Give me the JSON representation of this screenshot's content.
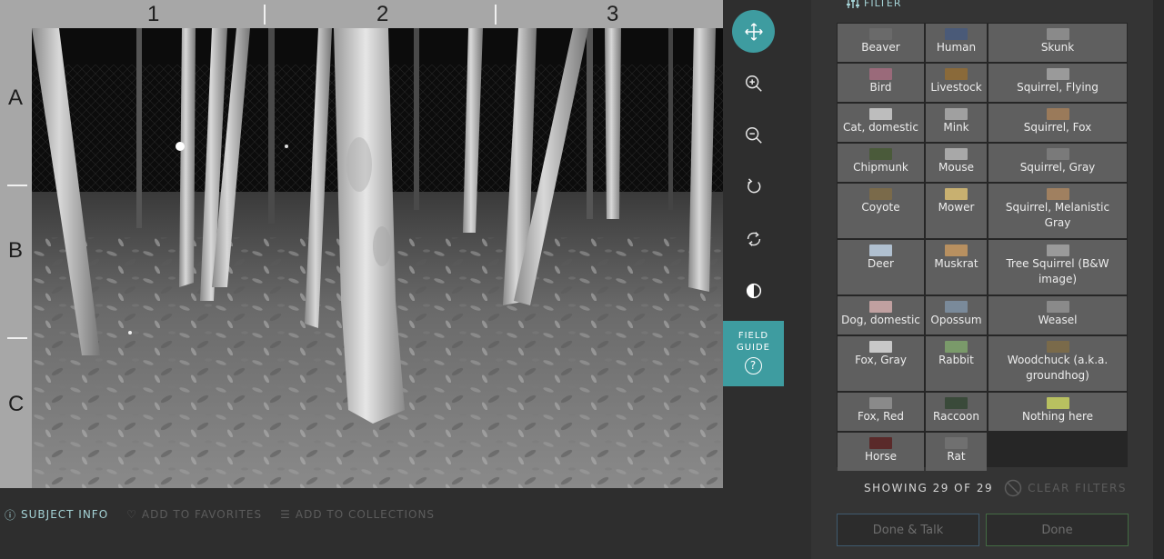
{
  "grid": {
    "columns": [
      "1",
      "2",
      "3"
    ],
    "rows": [
      "A",
      "B",
      "C"
    ]
  },
  "toolbar": {
    "tools": [
      {
        "name": "move-tool",
        "icon": "move-icon",
        "active": true
      },
      {
        "name": "zoom-in-tool",
        "icon": "zoom-in-icon",
        "active": false
      },
      {
        "name": "zoom-out-tool",
        "icon": "zoom-out-icon",
        "active": false
      },
      {
        "name": "rotate-tool",
        "icon": "rotate-icon",
        "active": false
      },
      {
        "name": "reset-tool",
        "icon": "reset-icon",
        "active": false
      },
      {
        "name": "invert-tool",
        "icon": "contrast-icon",
        "active": false
      }
    ],
    "field_guide_line1": "FIELD",
    "field_guide_line2": "GUIDE",
    "field_guide_icon": "?"
  },
  "bottom_links": {
    "subject_info": "SUBJECT INFO",
    "add_favorites": "ADD TO FAVORITES",
    "add_collections": "ADD TO COLLECTIONS"
  },
  "filter": {
    "label": "FILTER"
  },
  "species": [
    [
      "Beaver",
      "Human",
      "Skunk"
    ],
    [
      "Bird",
      "Livestock",
      "Squirrel, Flying"
    ],
    [
      "Cat, domestic",
      "Mink",
      "Squirrel, Fox"
    ],
    [
      "Chipmunk",
      "Mouse",
      "Squirrel, Gray"
    ],
    [
      "Coyote",
      "Mower",
      "Squirrel, Melanistic Gray"
    ],
    [
      "Deer",
      "Muskrat",
      "Tree Squirrel (B&W image)"
    ],
    [
      "Dog, domestic",
      "Opossum",
      "Weasel"
    ],
    [
      "Fox, Gray",
      "Rabbit",
      "Woodchuck (a.k.a. groundhog)"
    ],
    [
      "Fox, Red",
      "Raccoon",
      "Nothing here"
    ],
    [
      "Horse",
      "Rat"
    ]
  ],
  "thumb_colors": [
    [
      "#6a6a6a",
      "#4a5a78",
      "#8a8a8a"
    ],
    [
      "#9a6a7a",
      "#8a6a3a",
      "#9a9a9a"
    ],
    [
      "#bdbdbd",
      "#a0a0a0",
      "#9a7a5a"
    ],
    [
      "#4a5a3a",
      "#a8a8a8",
      "#7a7a7a"
    ],
    [
      "#7a6a4a",
      "#c8b070",
      "#a08060"
    ],
    [
      "#b0c0d0",
      "#b89060",
      "#9a9a9a"
    ],
    [
      "#c0a0a0",
      "#7a8a9a",
      "#8a8a8a"
    ],
    [
      "#c8c8c8",
      "#7a9a6a",
      "#7a6a4a"
    ],
    [
      "#8a8a8a",
      "#3a4a3a",
      "#b8c060"
    ],
    [
      "#5a2a2a",
      "#707070"
    ]
  ],
  "status": {
    "showing": "SHOWING 29 OF 29",
    "clear_filters": "CLEAR FILTERS"
  },
  "actions": {
    "done_talk": "Done & Talk",
    "done": "Done"
  }
}
